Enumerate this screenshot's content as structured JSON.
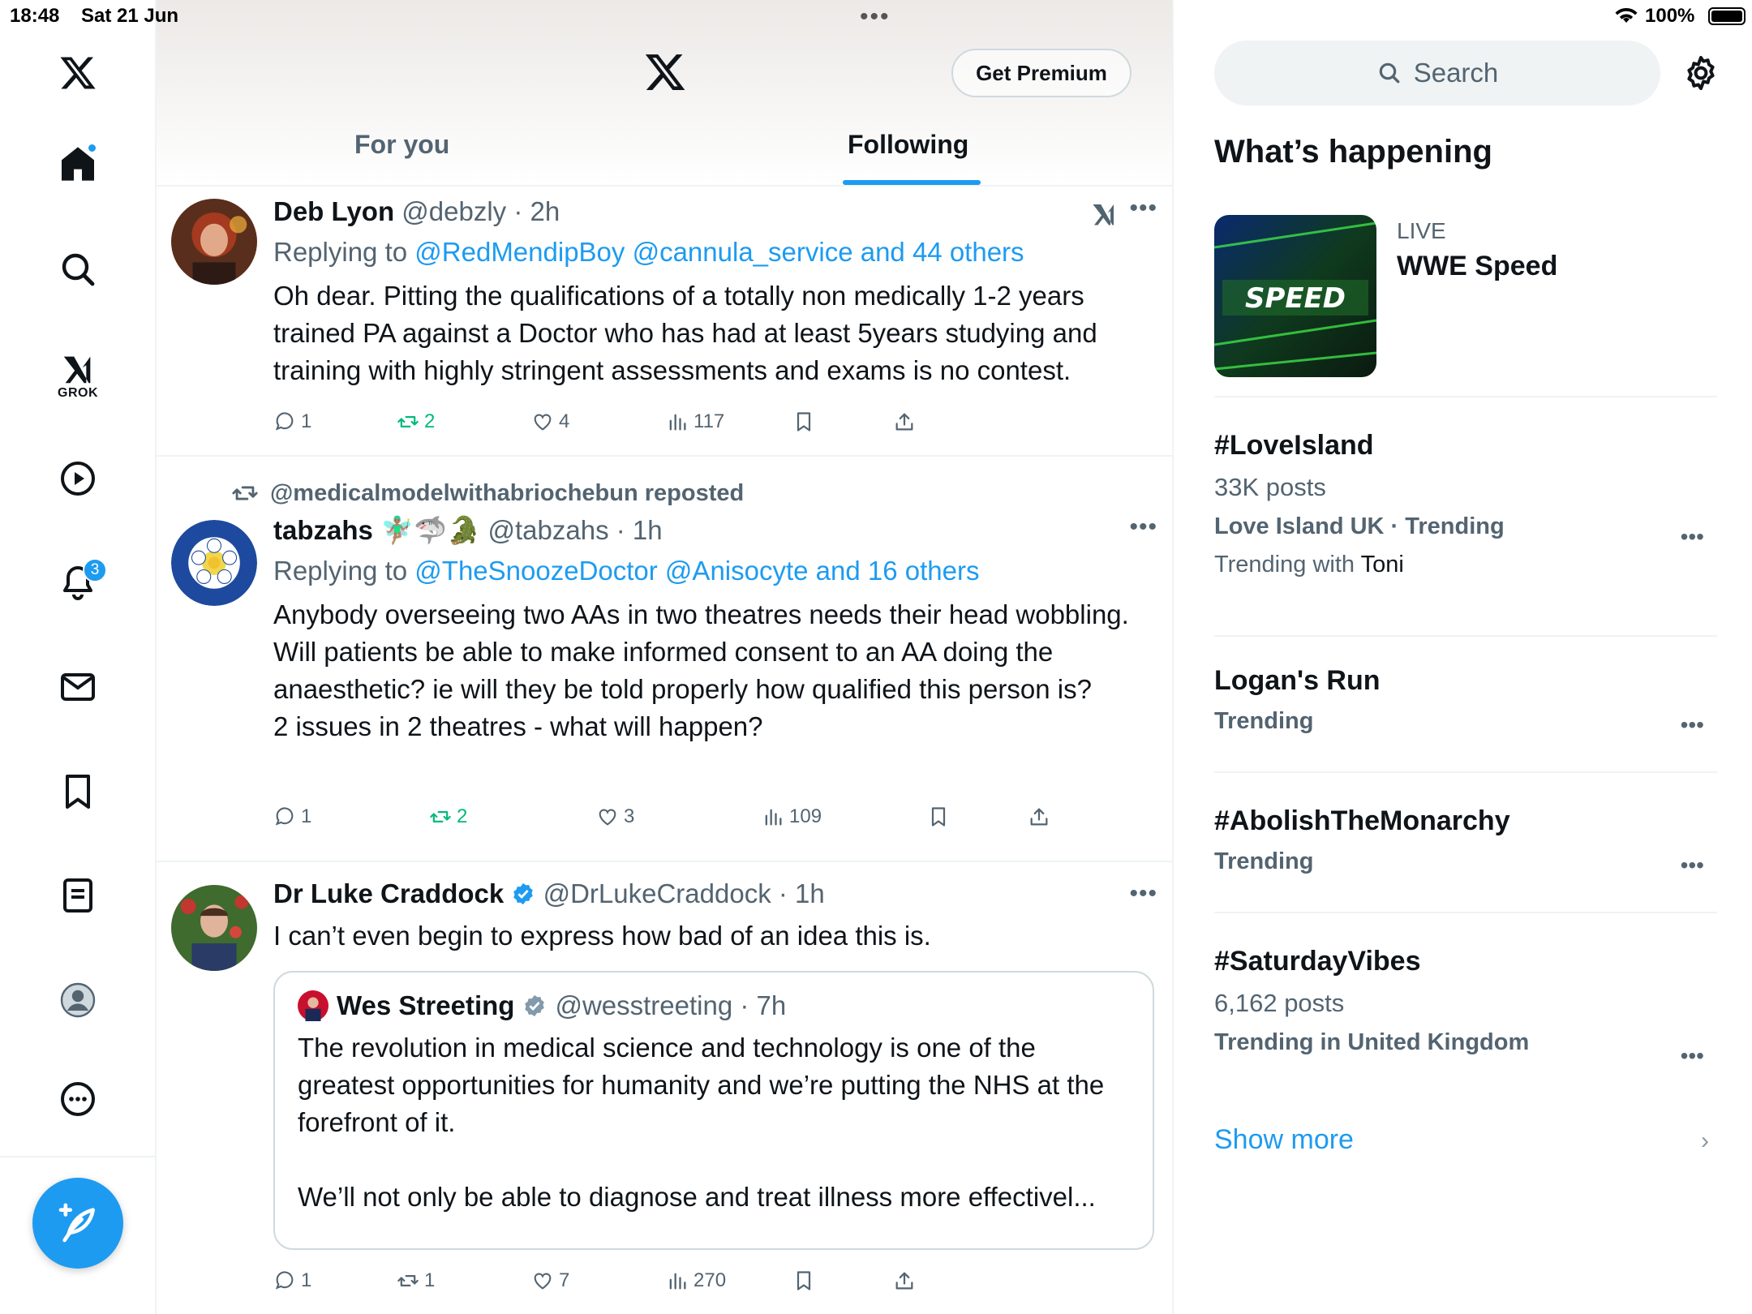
{
  "status_bar": {
    "time": "18:48",
    "date": "Sat 21 Jun",
    "battery": "100%"
  },
  "nav": {
    "grok_label": "GROK",
    "notifications_count": "3",
    "items": [
      "home-icon",
      "search-icon",
      "grok-icon",
      "video-icon",
      "bell-icon",
      "mail-icon",
      "bookmark-icon",
      "lists-icon",
      "profile-icon",
      "more-icon",
      "compose-icon"
    ]
  },
  "header": {
    "premium_label": "Get Premium",
    "tabs": [
      {
        "label": "For you"
      },
      {
        "label": "Following"
      }
    ]
  },
  "posts": [
    {
      "name": "Deb Lyon",
      "handle": "@debzly · 2h",
      "replying_prefix": "Replying to",
      "replying_mentions": "@RedMendipBoy @cannula_service and 44 others",
      "text": "Oh dear. Pitting the qualifications of a totally non medically 1-2 years trained PA against a Doctor who has had at least 5years studying and training with highly stringent assessments and exams is no contest.",
      "replies": "1",
      "reposts": "2",
      "likes": "4",
      "views": "117"
    },
    {
      "reposted_by": "@medicalmodelwithabriochebun reposted",
      "name": "tabzahs 🧚🏽‍♂️🦈🐊",
      "handle": "@tabzahs · 1h",
      "replying_prefix": "Replying to",
      "replying_mentions": "@TheSnoozeDoctor @Anisocyte and 16 others",
      "text_lines": [
        "Anybody overseeing two AAs in two theatres needs their head wobbling.",
        "Will patients be able to make informed consent to an AA doing the anaesthetic? ie will they be told properly how qualified this person is?",
        "2 issues in 2 theatres - what will happen?"
      ],
      "replies": "1",
      "reposts": "2",
      "likes": "3",
      "views": "109"
    },
    {
      "name": "Dr Luke Craddock",
      "handle": "@DrLukeCraddock · 1h",
      "text": "I can’t even begin to express how bad of an idea this is.",
      "quote": {
        "name": "Wes Streeting",
        "handle": "@wesstreeting · 7h",
        "text": "The revolution in medical science and technology is one of the greatest opportunities for humanity and we’re putting the NHS at the forefront of it.",
        "text2": "We’ll not only be able to diagnose and treat illness more effectivel..."
      },
      "replies": "1",
      "reposts": "1",
      "likes": "7",
      "views": "270"
    }
  ],
  "sidebar": {
    "search_placeholder": "Search",
    "heading": "What’s happening",
    "live": {
      "tag": "LIVE",
      "title": "WWE Speed",
      "image_text": "SPEED"
    },
    "trends": [
      {
        "title": "#LoveIsland",
        "posts": "33K posts",
        "context": "Love Island UK · Trending",
        "with_prefix": "Trending with",
        "with_name": "Toni"
      },
      {
        "title": "Logan's Run",
        "context": "Trending"
      },
      {
        "title": "#AbolishTheMonarchy",
        "context": "Trending"
      },
      {
        "title": "#SaturdayVibes",
        "posts": "6,162 posts",
        "context": "Trending in United Kingdom"
      }
    ],
    "show_more": "Show more"
  },
  "colors": {
    "accent": "#1d9bf0",
    "text": "#0f1419",
    "muted": "#536471",
    "repost_green": "#00ba7c"
  }
}
